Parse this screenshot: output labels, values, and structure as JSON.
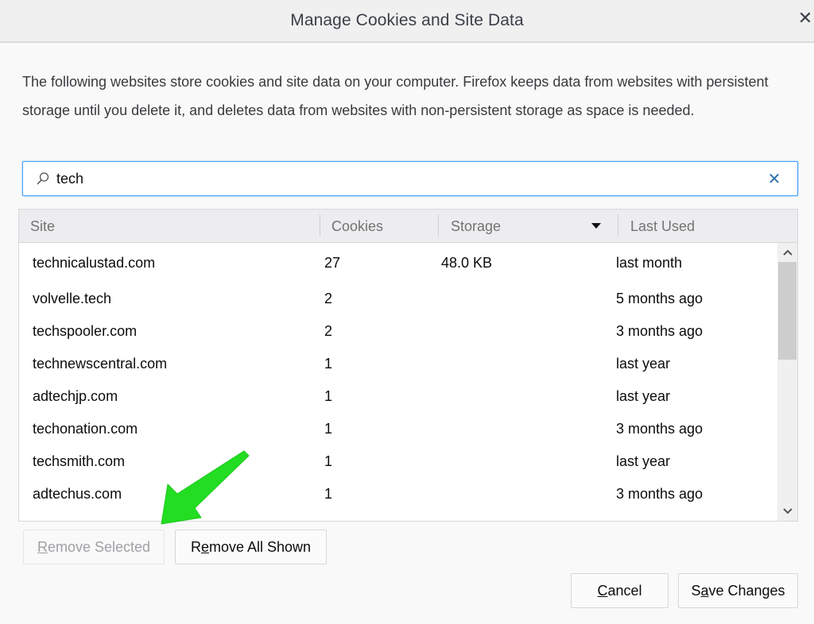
{
  "dialog": {
    "title": "Manage Cookies and Site Data",
    "close_icon": "close-icon"
  },
  "description": "The following websites store cookies and site data on your computer. Firefox keeps data from websites with persistent storage until you delete it, and deletes data from websites with non-persistent storage as space is needed.",
  "search": {
    "value": "tech",
    "icon": "search-icon",
    "clear_icon": "clear-icon",
    "focus_color": "#45a1ff"
  },
  "table": {
    "columns": [
      "Site",
      "Cookies",
      "Storage",
      "Last Used"
    ],
    "sorted_column": "Storage",
    "sort_direction": "descending",
    "rows": [
      {
        "site": "technicalustad.com",
        "cookies": "27",
        "storage": "48.0 KB",
        "last_used": "last month"
      },
      {
        "site": "volvelle.tech",
        "cookies": "2",
        "storage": "",
        "last_used": "5 months ago"
      },
      {
        "site": "techspooler.com",
        "cookies": "2",
        "storage": "",
        "last_used": "3 months ago"
      },
      {
        "site": "technewscentral.com",
        "cookies": "1",
        "storage": "",
        "last_used": "last year"
      },
      {
        "site": "adtechjp.com",
        "cookies": "1",
        "storage": "",
        "last_used": "last year"
      },
      {
        "site": "techonation.com",
        "cookies": "1",
        "storage": "",
        "last_used": "3 months ago"
      },
      {
        "site": "techsmith.com",
        "cookies": "1",
        "storage": "",
        "last_used": "last year"
      },
      {
        "site": "adtechus.com",
        "cookies": "1",
        "storage": "",
        "last_used": "3 months ago"
      }
    ]
  },
  "buttons": {
    "remove_selected": {
      "first": "R",
      "rest": "emove Selected",
      "disabled": true
    },
    "remove_all_shown": {
      "first": "R",
      "accel": "e",
      "rest": "move All Shown"
    },
    "cancel": {
      "accel": "C",
      "rest": "ancel"
    },
    "save_changes": {
      "pre": "S",
      "accel": "a",
      "rest": "ve Changes"
    }
  },
  "annotation": {
    "type": "arrow",
    "color": "#22dd22",
    "points_to": "Remove Selected"
  }
}
